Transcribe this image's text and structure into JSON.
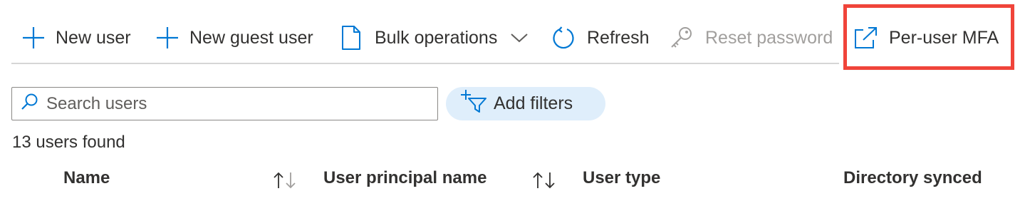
{
  "toolbar": {
    "new_user": "New user",
    "new_guest_user": "New guest user",
    "bulk_operations": "Bulk operations",
    "refresh": "Refresh",
    "reset_password": "Reset password",
    "per_user_mfa": "Per-user MFA"
  },
  "search": {
    "placeholder": "Search users",
    "value": ""
  },
  "filters": {
    "label": "Add filters"
  },
  "results": {
    "count_text": "13 users found"
  },
  "table": {
    "headers": [
      "Name",
      "User principal name",
      "User type",
      "Directory synced"
    ]
  },
  "colors": {
    "accent": "#0078d4",
    "highlight": "#f0443a",
    "disabled": "#a19f9d",
    "filter_bg": "#dfeefb"
  },
  "icons": {
    "new_user": "plus-icon",
    "new_guest_user": "plus-icon",
    "bulk_operations": "document-icon",
    "refresh": "refresh-icon",
    "reset_password": "key-icon",
    "per_user_mfa": "external-link-icon",
    "search": "search-icon",
    "filters": "add-filter-icon"
  }
}
